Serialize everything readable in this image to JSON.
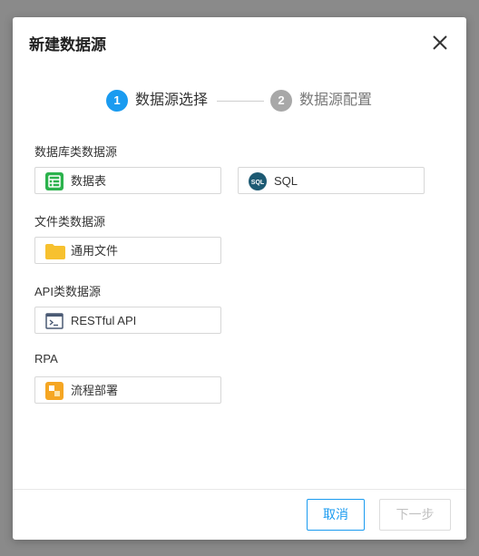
{
  "dialog": {
    "title": "新建数据源",
    "close_icon": "close-icon"
  },
  "steps": [
    {
      "number": "1",
      "label": "数据源选择",
      "state": "active",
      "color": "#1a9bf0"
    },
    {
      "number": "2",
      "label": "数据源配置",
      "state": "inactive",
      "color": "#a8a8a8"
    }
  ],
  "sections": [
    {
      "label": "数据库类数据源",
      "items": [
        {
          "label": "数据表",
          "icon": "table-icon"
        },
        {
          "label": "SQL",
          "icon": "sql-icon"
        }
      ]
    },
    {
      "label": "文件类数据源",
      "items": [
        {
          "label": "通用文件",
          "icon": "folder-icon"
        }
      ]
    },
    {
      "label": "API类数据源",
      "items": [
        {
          "label": "RESTful API",
          "icon": "terminal-icon"
        }
      ]
    },
    {
      "label": "RPA",
      "items": [
        {
          "label": "流程部署",
          "icon": "rpa-icon"
        }
      ]
    }
  ],
  "footer": {
    "cancel_label": "取消",
    "next_label": "下一步"
  },
  "colors": {
    "accent": "#1a9bf0",
    "table_icon": "#2bb24c",
    "sql_icon": "#1d5a73",
    "folder_icon": "#f7c12f",
    "rpa_icon": "#f5a623"
  }
}
